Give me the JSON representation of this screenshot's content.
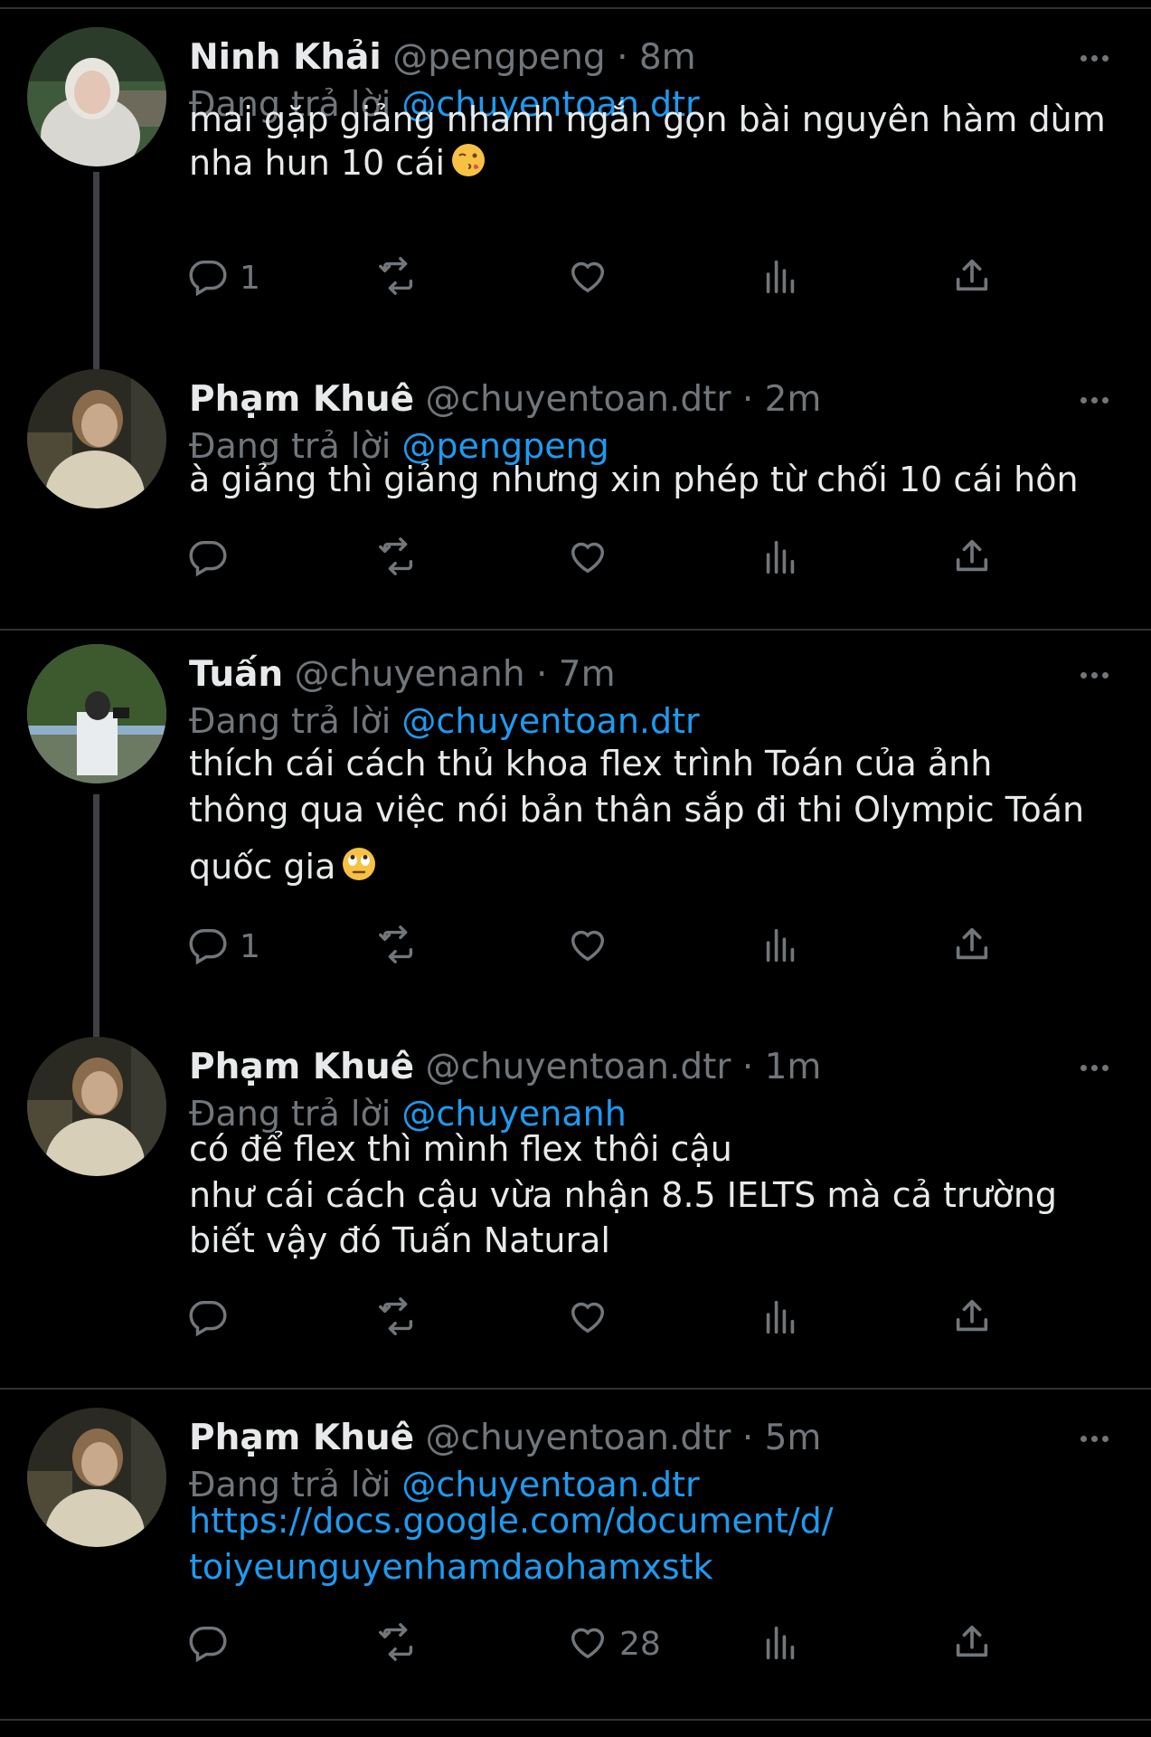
{
  "tweets": [
    {
      "name": "Ninh Khải",
      "handle": "@pengpeng",
      "time": "· 8m",
      "reply_label": "Đang trả lời",
      "reply_to": "@chuyentoan.dtr",
      "lines": [
        "mai gặp giảng nhanh ngắn gọn bài nguyên hàm dùm",
        "nha hun 10 cái"
      ],
      "emoji": "kissing-face-emoji",
      "reply_count": "1",
      "like_count": "",
      "avatar": "avatar-ninh-khai"
    },
    {
      "name": "Phạm Khuê",
      "handle": "@chuyentoan.dtr",
      "time": "· 2m",
      "reply_label": "Đang trả lời",
      "reply_to": "@pengpeng",
      "lines": [
        "à giảng thì giảng nhưng xin phép từ chối 10 cái hôn"
      ],
      "reply_count": "",
      "like_count": "",
      "avatar": "avatar-pham-khue"
    },
    {
      "name": "Tuấn",
      "handle": "@chuyenanh",
      "time": "· 7m",
      "reply_label": "Đang trả lời",
      "reply_to": "@chuyentoan.dtr",
      "lines": [
        "thích cái cách thủ khoa flex trình Toán của ảnh",
        "thông qua việc nói bản thân sắp đi thi Olympic Toán",
        "quốc gia"
      ],
      "emoji": "rolling-eyes-emoji",
      "reply_count": "1",
      "like_count": "",
      "avatar": "avatar-tuan"
    },
    {
      "name": "Phạm Khuê",
      "handle": "@chuyentoan.dtr",
      "time": "· 1m",
      "reply_label": "Đang trả lời",
      "reply_to": "@chuyenanh",
      "lines": [
        "có để flex thì mình flex thôi cậu",
        "như cái cách cậu vừa nhận 8.5 IELTS mà cả trường",
        "biết vậy đó Tuấn Natural"
      ],
      "reply_count": "",
      "like_count": "",
      "avatar": "avatar-pham-khue"
    },
    {
      "name": "Phạm Khuê",
      "handle": "@chuyentoan.dtr",
      "time": "· 5m",
      "reply_label": "Đang trả lời",
      "reply_to": "@chuyentoan.dtr",
      "lines": [
        "https://docs.google.com/document/d/",
        "toiyeunguyenhamdaohamxstk"
      ],
      "is_link": true,
      "reply_count": "",
      "like_count": "28",
      "avatar": "avatar-pham-khue"
    }
  ],
  "colors": {
    "background": "#000000",
    "text": "#e7e9ea",
    "muted": "#71767b",
    "accent": "#1d9bf0",
    "divider": "#2f3336"
  },
  "icons": [
    "reply-icon",
    "retweet-icon",
    "like-icon",
    "views-icon",
    "share-icon",
    "more-icon"
  ]
}
